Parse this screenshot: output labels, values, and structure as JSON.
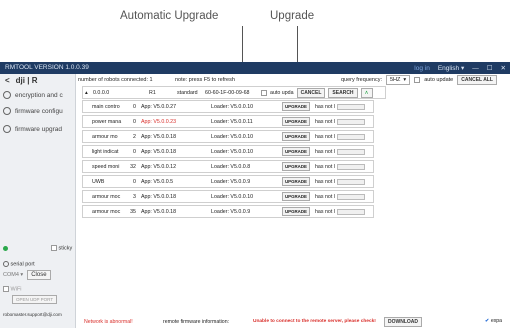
{
  "callouts": {
    "auto_upgrade": "Automatic Upgrade",
    "upgrade": "Upgrade"
  },
  "title": "RMTOOL VERSION 1.0.0.39",
  "titlebar": {
    "login": "log in",
    "lang": "English",
    "lang_arrow": "▾",
    "minimize": "—",
    "maximize": "☐",
    "close": "✕"
  },
  "sidebar": {
    "back": "<",
    "brand": "dji | R",
    "items": [
      {
        "label": "encryption and c",
        "icon": "lock-icon"
      },
      {
        "label": "firmware configu",
        "icon": "gear-icon"
      },
      {
        "label": "firmware upgrad",
        "icon": "gear-icon"
      }
    ],
    "sticky": "sticky",
    "serial_port": "serial port",
    "com": "COM4",
    "close": "Close",
    "wifi": "WiFi",
    "open_udp": "OPEN UDP PORT",
    "email": "robomaster.support@dji.com"
  },
  "top": {
    "robots": "number of robots connected:  1",
    "note": "note: press F5 to refresh",
    "qf_label": "query frequency:",
    "qf_value": "5HZ",
    "auto_update": "auto update",
    "cancel_all": "CANCEL ALL"
  },
  "robot": {
    "ip": "0.0.0.0",
    "id": "R1",
    "type": "standard",
    "mac": "60-60-1F-00-09-68",
    "auto_upd": "auto upda",
    "cancel": "CANCEL",
    "search": "SEARCH",
    "expand": "∧"
  },
  "modules": [
    {
      "name": "main contro",
      "num": "0",
      "app": "App: V5.0.0.27",
      "app_red": false,
      "loader": "Loader: V5.0.0.10",
      "upgrade": "UPGRADE",
      "status": "has not l"
    },
    {
      "name": "power mana",
      "num": "0",
      "app": "App: V5.0.0.23",
      "app_red": true,
      "loader": "Loader: V5.0.0.11",
      "upgrade": "UPGRADE",
      "status": "has not l"
    },
    {
      "name": "armour mo",
      "num": "2",
      "app": "App: V5.0.0.18",
      "app_red": false,
      "loader": "Loader: V5.0.0.10",
      "upgrade": "UPGRADE",
      "status": "has not l"
    },
    {
      "name": "light indicat",
      "num": "0",
      "app": "App: V5.0.0.18",
      "app_red": false,
      "loader": "Loader: V5.0.0.10",
      "upgrade": "UPGRADE",
      "status": "has not l"
    },
    {
      "name": "speed moni",
      "num": "32",
      "app": "App: V5.0.0.12",
      "app_red": false,
      "loader": "Loader: V5.0.0.8",
      "upgrade": "UPGRADE",
      "status": "has not l"
    },
    {
      "name": "UWB",
      "num": "0",
      "app": "App: V5.0.0.5",
      "app_red": false,
      "loader": "Loader: V5.0.0.9",
      "upgrade": "UPGRADE",
      "status": "has not l"
    },
    {
      "name": "armour moc",
      "num": "3",
      "app": "App: V5.0.0.18",
      "app_red": false,
      "loader": "Loader: V5.0.0.10",
      "upgrade": "UPGRADE",
      "status": "has not l"
    },
    {
      "name": "armour moc",
      "num": "35",
      "app": "App: V5.0.0.18",
      "app_red": false,
      "loader": "Loader: V5.0.0.9",
      "upgrade": "UPGRADE",
      "status": "has not l"
    }
  ],
  "status": {
    "network": "Network is abnormal!",
    "remote_label": "remote firmware information:",
    "remote_msg": "Unable to connect to the remote server, please check!",
    "download": "DOWNLOAD",
    "expand": "expa"
  },
  "colors": {
    "titlebar": "#1f3b63",
    "accent_red": "#d9302c",
    "green": "#2aa84a"
  }
}
